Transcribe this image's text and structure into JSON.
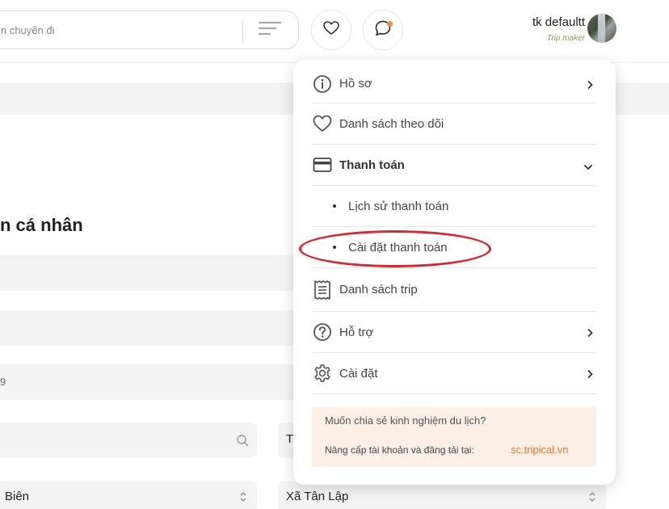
{
  "colors": {
    "accent": "#f08c3c",
    "role": "#8aa34a",
    "link": "#e8782a",
    "highlight_ring": "#d8282f"
  },
  "header": {
    "search": {
      "placeholder": "n chuyến đi"
    },
    "icons": {
      "filter": "filter-lines-icon",
      "favorites": "heart-icon",
      "chat": "chat-bubble-icon"
    },
    "user": {
      "name": "tk defaultt",
      "role": "Trip maker"
    }
  },
  "background": {
    "title": "n cá nhân",
    "field_value": "9",
    "selects": {
      "left": "Biên",
      "right": "Xã Tân Lập",
      "partial_right_label": "T"
    }
  },
  "menu": {
    "profile": {
      "label": "Hồ sơ",
      "icon": "info-icon"
    },
    "watchlist": {
      "label": "Danh sách theo dõi",
      "icon": "heart-icon"
    },
    "payment": {
      "label": "Thanh toán",
      "icon": "credit-card-icon"
    },
    "payment_history": {
      "label": "Lịch sử thanh toán"
    },
    "payment_settings": {
      "label": "Cài đặt thanh toán"
    },
    "trips": {
      "label": "Danh sách trip",
      "icon": "receipt-icon"
    },
    "support": {
      "label": "Hỗ trợ",
      "icon": "help-icon"
    },
    "settings": {
      "label": "Cài đặt",
      "icon": "gear-icon"
    },
    "promo": {
      "question": "Muốn chia sẻ kinh nghiệm du lịch?",
      "text": "Nâng cấp tài khoản và đăng tải tại:",
      "link": "sc.tripical.vn"
    }
  }
}
